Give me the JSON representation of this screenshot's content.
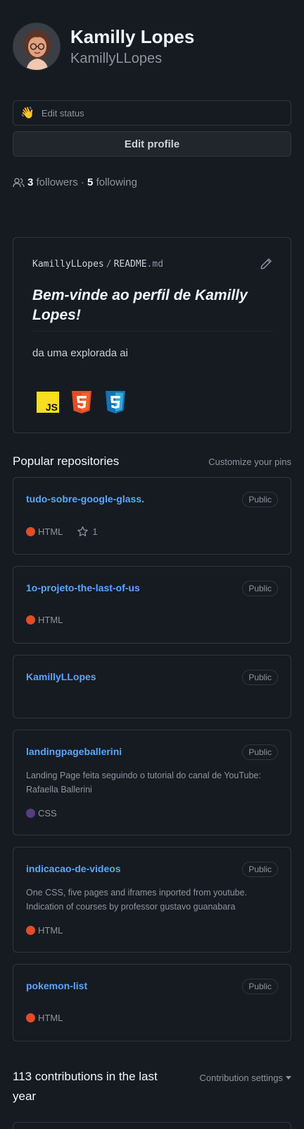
{
  "profile": {
    "name": "Kamilly Lopes",
    "login": "KamillyLLopes",
    "status_label": "Edit status",
    "status_emoji": "👋",
    "edit_profile_label": "Edit profile",
    "followers_count": "3",
    "followers_label": "followers",
    "separator": "·",
    "following_count": "5",
    "following_label": "following"
  },
  "readme": {
    "owner": "KamillyLLopes",
    "slash": "/",
    "file_base": "README",
    "file_ext": ".md",
    "title": "Bem-vinde ao perfil de Kamilly Lopes!",
    "text": "da uma explorada ai",
    "badges": [
      "javascript-icon",
      "html5-icon",
      "css3-icon"
    ],
    "badge_js_text": "JS"
  },
  "pinned": {
    "title": "Popular repositories",
    "customize_label": "Customize your pins",
    "repos": [
      {
        "name": "tudo-sobre-google-glass.",
        "visibility": "Public",
        "description": "",
        "language": "HTML",
        "language_color": "#e34c26",
        "stars": "1"
      },
      {
        "name": "1o-projeto-the-last-of-us",
        "visibility": "Public",
        "description": "",
        "language": "HTML",
        "language_color": "#e34c26"
      },
      {
        "name": "KamillyLLopes",
        "visibility": "Public",
        "description": "",
        "language": ""
      },
      {
        "name": "landingpageballerini",
        "visibility": "Public",
        "description": "Landing Page feita seguindo o tutorial do canal de YouTube: Rafaella Ballerini",
        "language": "CSS",
        "language_color": "#563d7c"
      },
      {
        "name": "indicacao-de-videos",
        "visibility": "Public",
        "description": "One CSS, five pages and iframes inported from youtube. Indication of courses by professor gustavo guanabara",
        "language": "HTML",
        "language_color": "#e34c26"
      },
      {
        "name": "pokemon-list",
        "visibility": "Public",
        "description": "",
        "language": "HTML",
        "language_color": "#e34c26"
      }
    ]
  },
  "contributions": {
    "title": "113 contributions in the last year",
    "settings_label": "Contribution settings"
  },
  "colors": {
    "background": "#161b22",
    "border": "#30363d",
    "link": "#58a6ff",
    "muted": "#8b949e"
  }
}
